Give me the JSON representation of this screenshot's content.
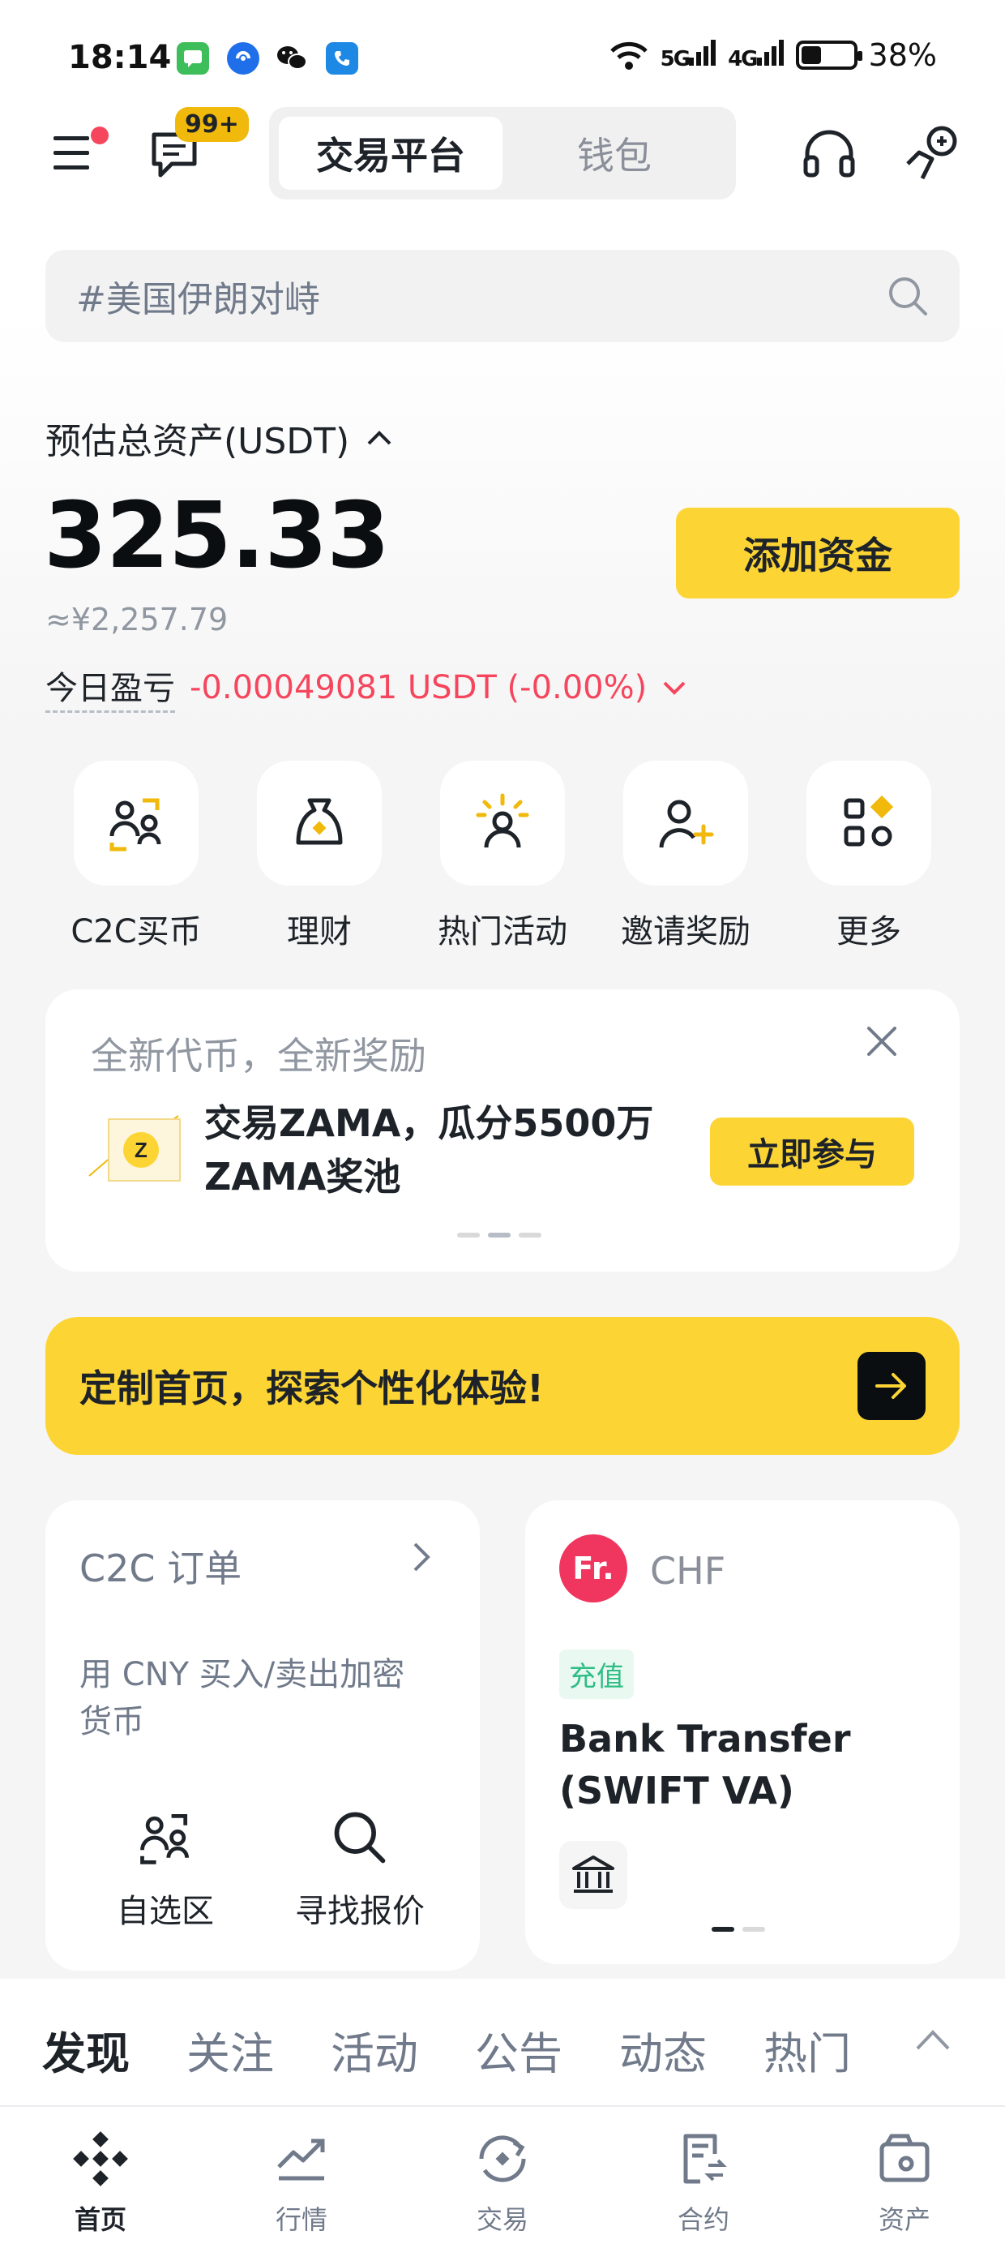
{
  "status_bar": {
    "time": "18:14",
    "battery": "38%",
    "signal_5g": "5G",
    "signal_4g": "4G",
    "battery_level": 0.38,
    "app_icons": [
      "messages-icon",
      "browser-icon",
      "wechat-icon",
      "phone-icon"
    ]
  },
  "header": {
    "notification_badge": "99+",
    "segment": {
      "tabs": [
        "交易平台",
        "钱包"
      ],
      "active_index": 0
    }
  },
  "search": {
    "placeholder": "#美国伊朗对峙"
  },
  "assets": {
    "label": "预估总资产(USDT)",
    "balance": "325.33",
    "approx": "≈¥2,257.79",
    "pnl_label": "今日盈亏",
    "pnl_value": "-0.00049081 USDT (-0.00%)",
    "add_funds": "添加资金"
  },
  "quick_actions": [
    {
      "label": "C2C买币",
      "icon": "c2c-users-icon"
    },
    {
      "label": "理财",
      "icon": "money-bag-icon"
    },
    {
      "label": "热门活动",
      "icon": "sparkle-user-icon"
    },
    {
      "label": "邀请奖励",
      "icon": "add-user-icon"
    },
    {
      "label": "更多",
      "icon": "grid-more-icon"
    }
  ],
  "promo": {
    "title": "全新代币，全新奖励",
    "body": "交易ZAMA，瓜分5500万ZAMA奖池",
    "cta": "立即参与",
    "coin_letter": "Z",
    "pages": 3,
    "active_page": 1
  },
  "customize": {
    "text": "定制首页，探索个性化体验!"
  },
  "c2c_card": {
    "title": "C2C 订单",
    "desc": "用 CNY 买入/卖出加密货币",
    "actions": [
      "自选区",
      "寻找报价"
    ]
  },
  "fiat_card": {
    "logo": "Fr.",
    "currency": "CHF",
    "tag": "充值",
    "method": "Bank Transfer (SWIFT VA)",
    "pages": 2,
    "active_page": 0
  },
  "discover_tabs": {
    "items": [
      "发现",
      "关注",
      "活动",
      "公告",
      "动态",
      "热门"
    ],
    "active_index": 0
  },
  "bottom_nav": {
    "items": [
      {
        "label": "首页",
        "icon": "binance-logo-icon"
      },
      {
        "label": "行情",
        "icon": "market-chart-icon"
      },
      {
        "label": "交易",
        "icon": "trade-icon"
      },
      {
        "label": "合约",
        "icon": "futures-icon"
      },
      {
        "label": "资产",
        "icon": "wallet-icon"
      }
    ],
    "active_index": 0
  },
  "colors": {
    "brand_yellow": "#FCD535",
    "accent_gold": "#F0B90B",
    "negative_red": "#F6465D",
    "positive_green": "#2EBD85"
  }
}
